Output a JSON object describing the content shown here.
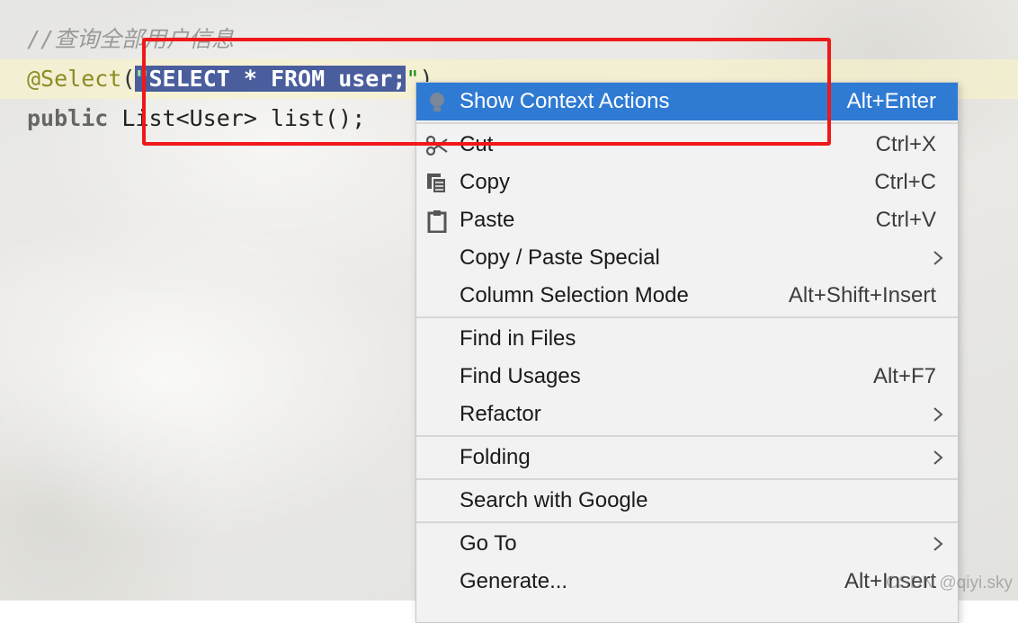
{
  "editor": {
    "comment": "//查询全部用户信息",
    "annotation": "@Select",
    "open_paren": "(",
    "quote_open": "\"",
    "selected_sql": "SELECT * FROM user;",
    "quote_close": "\"",
    "close_paren": ")",
    "public_kw": "public",
    "method_rest": " List<User> list();"
  },
  "context_menu": {
    "items": [
      {
        "label": "Show Context Actions",
        "shortcut": "Alt+Enter",
        "icon": "lightbulb-icon",
        "active": true
      },
      {
        "label": "Cut",
        "shortcut": "Ctrl+X",
        "icon": "scissors-icon"
      },
      {
        "label": "Copy",
        "shortcut": "Ctrl+C",
        "icon": "copy-icon"
      },
      {
        "label": "Paste",
        "shortcut": "Ctrl+V",
        "icon": "clipboard-icon"
      },
      {
        "label": "Copy / Paste Special",
        "submenu": true
      },
      {
        "label": "Column Selection Mode",
        "shortcut": "Alt+Shift+Insert"
      },
      {
        "label": "Find in Files"
      },
      {
        "label": "Find Usages",
        "shortcut": "Alt+F7"
      },
      {
        "label": "Refactor",
        "submenu": true
      },
      {
        "label": "Folding",
        "submenu": true
      },
      {
        "label": "Search with Google"
      },
      {
        "label": "Go To",
        "submenu": true
      },
      {
        "label": "Generate...",
        "shortcut": "Alt+Insert"
      }
    ]
  },
  "watermark": "CSDN @qiyi.sky",
  "colors": {
    "highlight_red": "#f01818",
    "menu_active": "#2f7bd3",
    "selection": "#4a5d9c",
    "annotation": "#8c8c22",
    "string": "#138a13"
  }
}
